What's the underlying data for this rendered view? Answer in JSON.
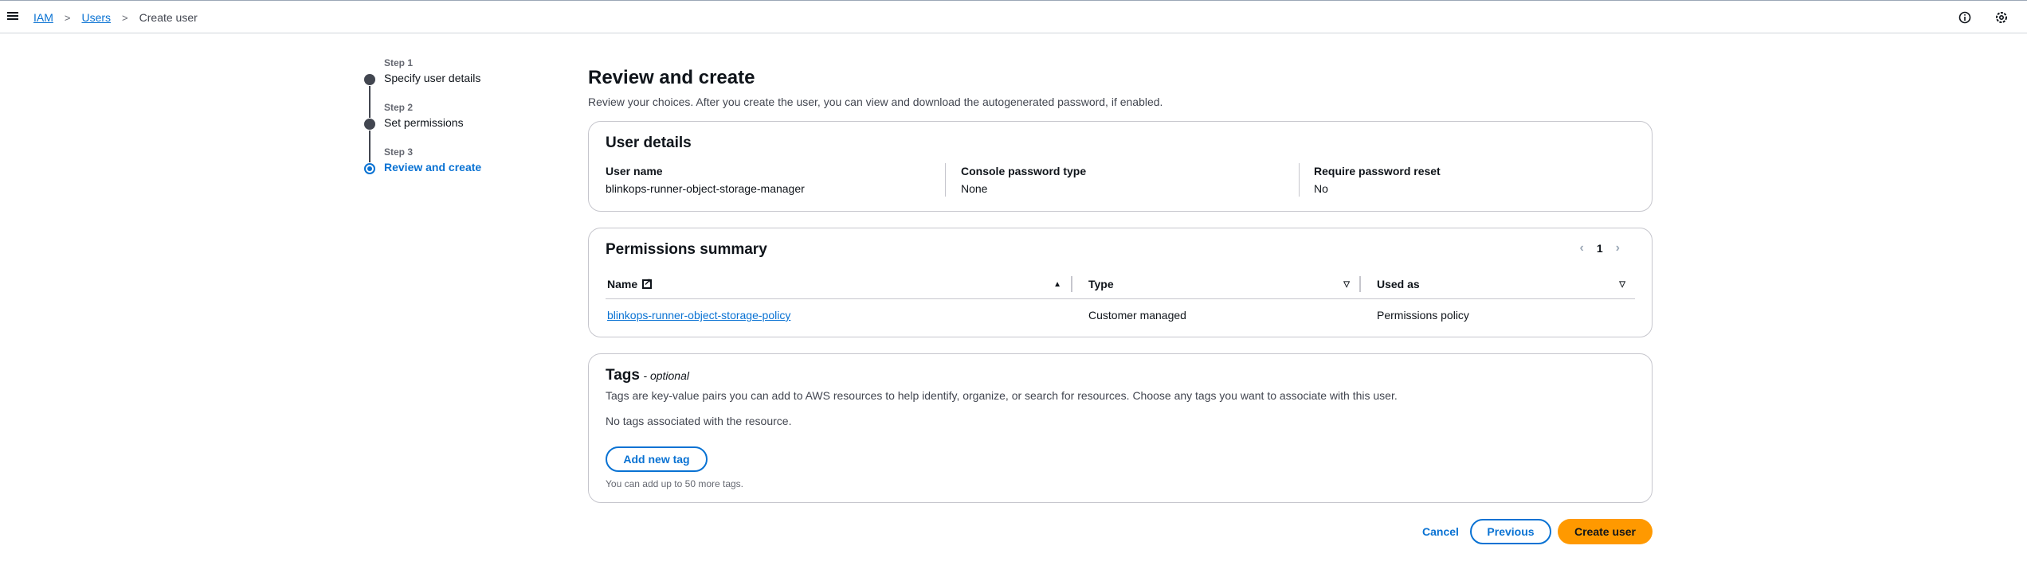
{
  "breadcrumb": {
    "items": [
      "IAM",
      "Users"
    ],
    "current": "Create user"
  },
  "steps": [
    {
      "num": "Step 1",
      "label": "Specify user details"
    },
    {
      "num": "Step 2",
      "label": "Set permissions"
    },
    {
      "num": "Step 3",
      "label": "Review and create"
    }
  ],
  "page": {
    "title": "Review and create",
    "description": "Review your choices. After you create the user, you can view and download the autogenerated password, if enabled."
  },
  "user_details": {
    "title": "User details",
    "fields": [
      {
        "key": "User name",
        "value": "blinkops-runner-object-storage-manager"
      },
      {
        "key": "Console password type",
        "value": "None"
      },
      {
        "key": "Require password reset",
        "value": "No"
      }
    ]
  },
  "permissions": {
    "title": "Permissions summary",
    "page": "1",
    "columns": [
      "Name",
      "Type",
      "Used as"
    ],
    "rows": [
      {
        "name": "blinkops-runner-object-storage-policy",
        "type": "Customer managed",
        "used_as": "Permissions policy"
      }
    ]
  },
  "tags": {
    "title": "Tags",
    "optional": "- optional",
    "description": "Tags are key-value pairs you can add to AWS resources to help identify, organize, or search for resources. Choose any tags you want to associate with this user.",
    "empty": "No tags associated with the resource.",
    "add_label": "Add new tag",
    "limit_note": "You can add up to 50 more tags."
  },
  "footer": {
    "cancel": "Cancel",
    "previous": "Previous",
    "create": "Create user"
  },
  "colors": {
    "accent": "#0972d3",
    "primary_button": "#ff9900"
  },
  "icons": [
    "menu-icon",
    "info-icon",
    "settings-icon",
    "external-link-icon",
    "chevron-left-icon",
    "chevron-right-icon",
    "sort-ascending-icon",
    "sort-icon"
  ]
}
